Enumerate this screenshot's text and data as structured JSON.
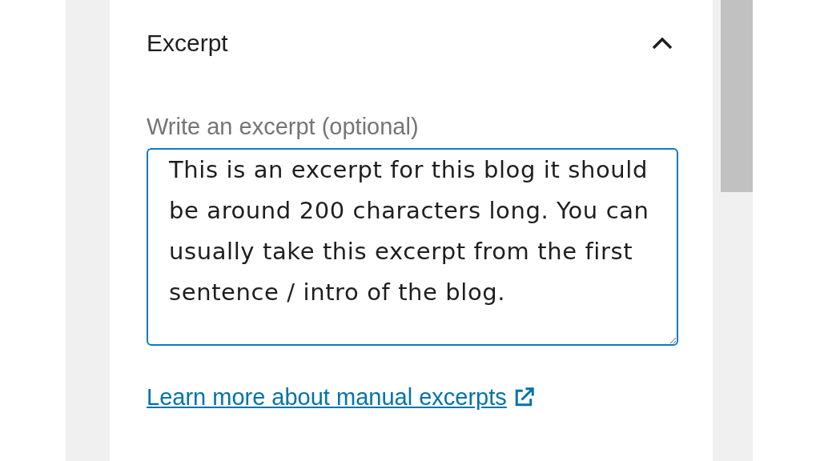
{
  "panel": {
    "title": "Excerpt",
    "expanded": true
  },
  "excerpt": {
    "label": "Write an excerpt (optional)",
    "value": "This is an excerpt for this blog it should be around 200 characters long. You can usually take this excerpt from the first sentence / intro of the blog."
  },
  "link": {
    "text": "Learn more about manual excerpts"
  }
}
